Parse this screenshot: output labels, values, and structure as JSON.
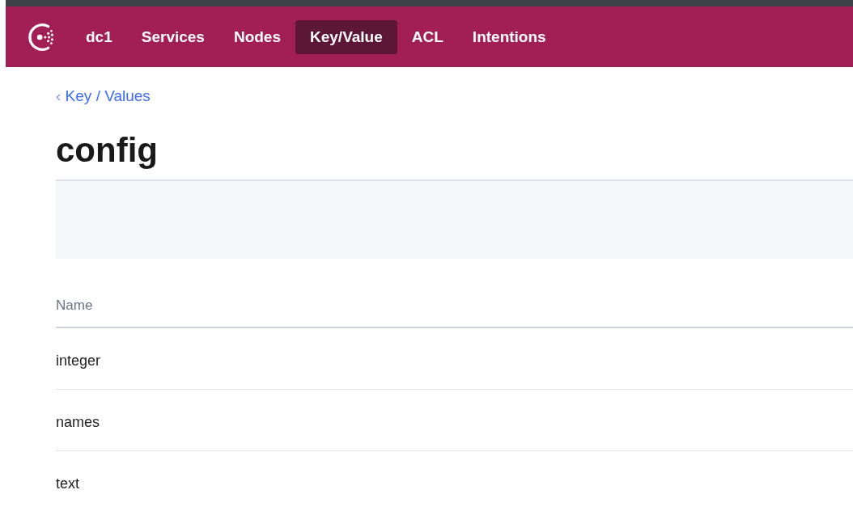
{
  "nav": {
    "items": [
      {
        "label": "dc1",
        "selected": false
      },
      {
        "label": "Services",
        "selected": false
      },
      {
        "label": "Nodes",
        "selected": false
      },
      {
        "label": "Key/Value",
        "selected": true
      },
      {
        "label": "ACL",
        "selected": false
      },
      {
        "label": "Intentions",
        "selected": false
      }
    ]
  },
  "breadcrumb": {
    "arrow": "‹",
    "label": "Key / Values"
  },
  "title": "config",
  "table": {
    "columns": [
      "Name"
    ],
    "rows": [
      {
        "name": "integer"
      },
      {
        "name": "names"
      },
      {
        "name": "text"
      }
    ]
  }
}
